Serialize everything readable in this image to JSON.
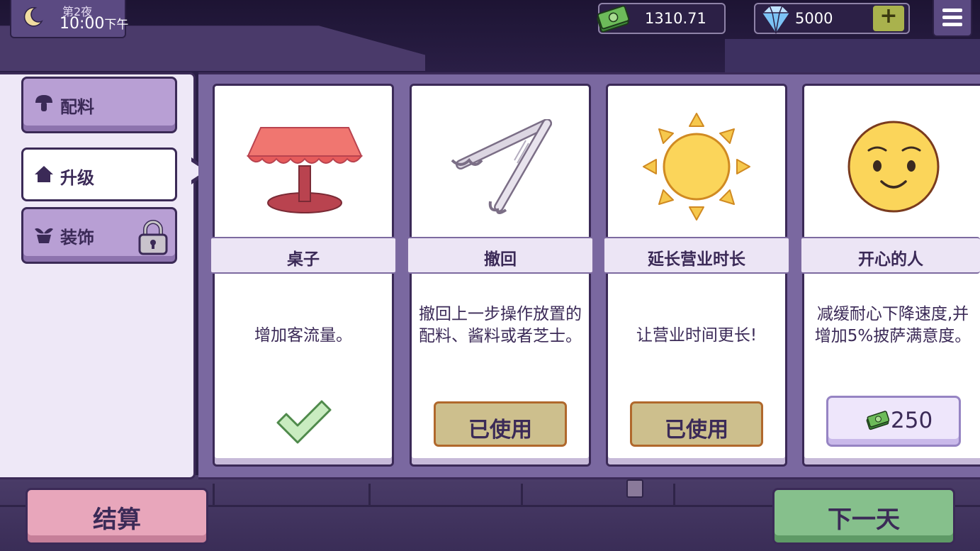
{
  "hud": {
    "day": "第2夜",
    "time": "10:00",
    "period": "下午",
    "cash": "1310.71",
    "gems": "5000",
    "add_label": "+"
  },
  "sidebar": {
    "tabs": [
      {
        "label": "配料",
        "icon": "mushroom-icon",
        "active": false,
        "locked": false
      },
      {
        "label": "升级",
        "icon": "house-icon",
        "active": true,
        "locked": false
      },
      {
        "label": "装饰",
        "icon": "plant-icon",
        "active": false,
        "locked": true
      }
    ]
  },
  "cards": [
    {
      "title": "桌子",
      "description": "增加客流量。",
      "icon": "table-icon",
      "status": "owned"
    },
    {
      "title": "撤回",
      "description": "撤回上一步操作放置的配料、酱料或者芝士。",
      "icon": "tongs-icon",
      "status": "used",
      "status_label": "已使用"
    },
    {
      "title": "延长营业时长",
      "description": "让营业时间更长!",
      "icon": "sun-icon",
      "status": "used",
      "status_label": "已使用"
    },
    {
      "title": "开心的人",
      "description": "减缓耐心下降速度,并增加5%披萨满意度。",
      "icon": "smiley-icon",
      "status": "buy",
      "price": "250"
    }
  ],
  "footer": {
    "settle_label": "结算",
    "next_day_label": "下一天"
  },
  "colors": {
    "panel": "#7a68a0",
    "outline": "#3b2a57",
    "settle": "#e8a6bb",
    "next": "#86c08c",
    "used": "#cdbf8d"
  }
}
